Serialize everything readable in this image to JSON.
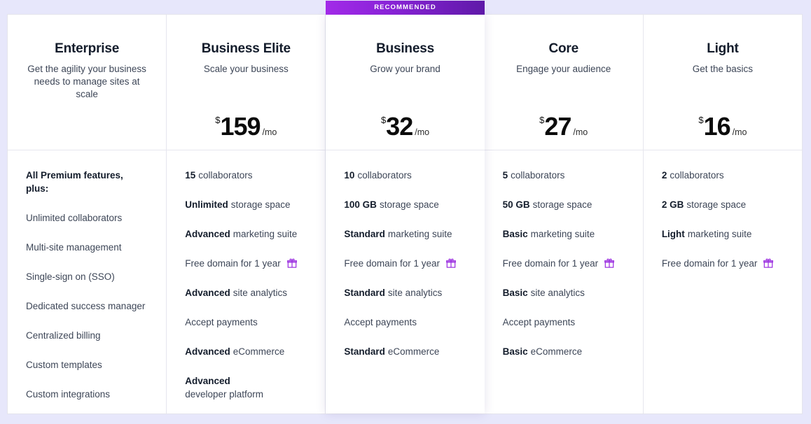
{
  "theme": {
    "page_background": "#e7e7fb",
    "card_background": "#ffffff",
    "accent_purple": "#a22ae8",
    "accent_purple_dark": "#5f19a8",
    "heading_color": "#131c2b",
    "body_color": "#3d4657",
    "divider_color": "#e6e6ee"
  },
  "badge": {
    "label": "RECOMMENDED"
  },
  "gift_icon_name": "gift-icon",
  "plans": [
    {
      "id": "enterprise",
      "name": "Enterprise",
      "tagline": "Get the agility your business needs to manage sites at scale",
      "has_price": false,
      "currency": "",
      "amount": "",
      "period": "",
      "recommended": false,
      "features": [
        {
          "strong": "",
          "text": "All Premium features, plus:",
          "heading": true,
          "gift": false
        },
        {
          "strong": "",
          "text": "Unlimited collaborators",
          "heading": false,
          "gift": false
        },
        {
          "strong": "",
          "text": "Multi-site management",
          "heading": false,
          "gift": false
        },
        {
          "strong": "",
          "text": "Single-sign on (SSO)",
          "heading": false,
          "gift": false
        },
        {
          "strong": "",
          "text": "Dedicated success manager",
          "heading": false,
          "gift": false
        },
        {
          "strong": "",
          "text": "Centralized billing",
          "heading": false,
          "gift": false
        },
        {
          "strong": "",
          "text": "Custom templates",
          "heading": false,
          "gift": false
        },
        {
          "strong": "",
          "text": "Custom integrations",
          "heading": false,
          "gift": false
        }
      ]
    },
    {
      "id": "business-elite",
      "name": "Business Elite",
      "tagline": "Scale your business",
      "has_price": true,
      "currency": "$",
      "amount": "159",
      "period": "/mo",
      "recommended": false,
      "features": [
        {
          "strong": "15",
          "text": "collaborators",
          "heading": false,
          "gift": false
        },
        {
          "strong": "Unlimited",
          "text": "storage space",
          "heading": false,
          "gift": false
        },
        {
          "strong": "Advanced",
          "text": "marketing suite",
          "heading": false,
          "gift": false
        },
        {
          "strong": "",
          "text": "Free domain for 1 year",
          "heading": false,
          "gift": true
        },
        {
          "strong": "Advanced",
          "text": "site analytics",
          "heading": false,
          "gift": false
        },
        {
          "strong": "",
          "text": "Accept payments",
          "heading": false,
          "gift": false
        },
        {
          "strong": "Advanced",
          "text": "eCommerce",
          "heading": false,
          "gift": false
        },
        {
          "strong": "Advanced",
          "text": "developer platform",
          "heading": false,
          "gift": false
        }
      ]
    },
    {
      "id": "business",
      "name": "Business",
      "tagline": "Grow your brand",
      "has_price": true,
      "currency": "$",
      "amount": "32",
      "period": "/mo",
      "recommended": true,
      "features": [
        {
          "strong": "10",
          "text": "collaborators",
          "heading": false,
          "gift": false
        },
        {
          "strong": "100 GB",
          "text": "storage space",
          "heading": false,
          "gift": false
        },
        {
          "strong": "Standard",
          "text": "marketing suite",
          "heading": false,
          "gift": false
        },
        {
          "strong": "",
          "text": "Free domain for 1 year",
          "heading": false,
          "gift": true
        },
        {
          "strong": "Standard",
          "text": "site analytics",
          "heading": false,
          "gift": false
        },
        {
          "strong": "",
          "text": "Accept payments",
          "heading": false,
          "gift": false
        },
        {
          "strong": "Standard",
          "text": "eCommerce",
          "heading": false,
          "gift": false
        }
      ]
    },
    {
      "id": "core",
      "name": "Core",
      "tagline": "Engage your audience",
      "has_price": true,
      "currency": "$",
      "amount": "27",
      "period": "/mo",
      "recommended": false,
      "features": [
        {
          "strong": "5",
          "text": "collaborators",
          "heading": false,
          "gift": false
        },
        {
          "strong": "50 GB",
          "text": "storage space",
          "heading": false,
          "gift": false
        },
        {
          "strong": "Basic",
          "text": "marketing suite",
          "heading": false,
          "gift": false
        },
        {
          "strong": "",
          "text": "Free domain for 1 year",
          "heading": false,
          "gift": true
        },
        {
          "strong": "Basic",
          "text": "site analytics",
          "heading": false,
          "gift": false
        },
        {
          "strong": "",
          "text": "Accept payments",
          "heading": false,
          "gift": false
        },
        {
          "strong": "Basic",
          "text": "eCommerce",
          "heading": false,
          "gift": false
        }
      ]
    },
    {
      "id": "light",
      "name": "Light",
      "tagline": "Get the basics",
      "has_price": true,
      "currency": "$",
      "amount": "16",
      "period": "/mo",
      "recommended": false,
      "features": [
        {
          "strong": "2",
          "text": "collaborators",
          "heading": false,
          "gift": false
        },
        {
          "strong": "2 GB",
          "text": "storage space",
          "heading": false,
          "gift": false
        },
        {
          "strong": "Light",
          "text": "marketing suite",
          "heading": false,
          "gift": false
        },
        {
          "strong": "",
          "text": "Free domain for 1 year",
          "heading": false,
          "gift": true
        }
      ]
    }
  ]
}
